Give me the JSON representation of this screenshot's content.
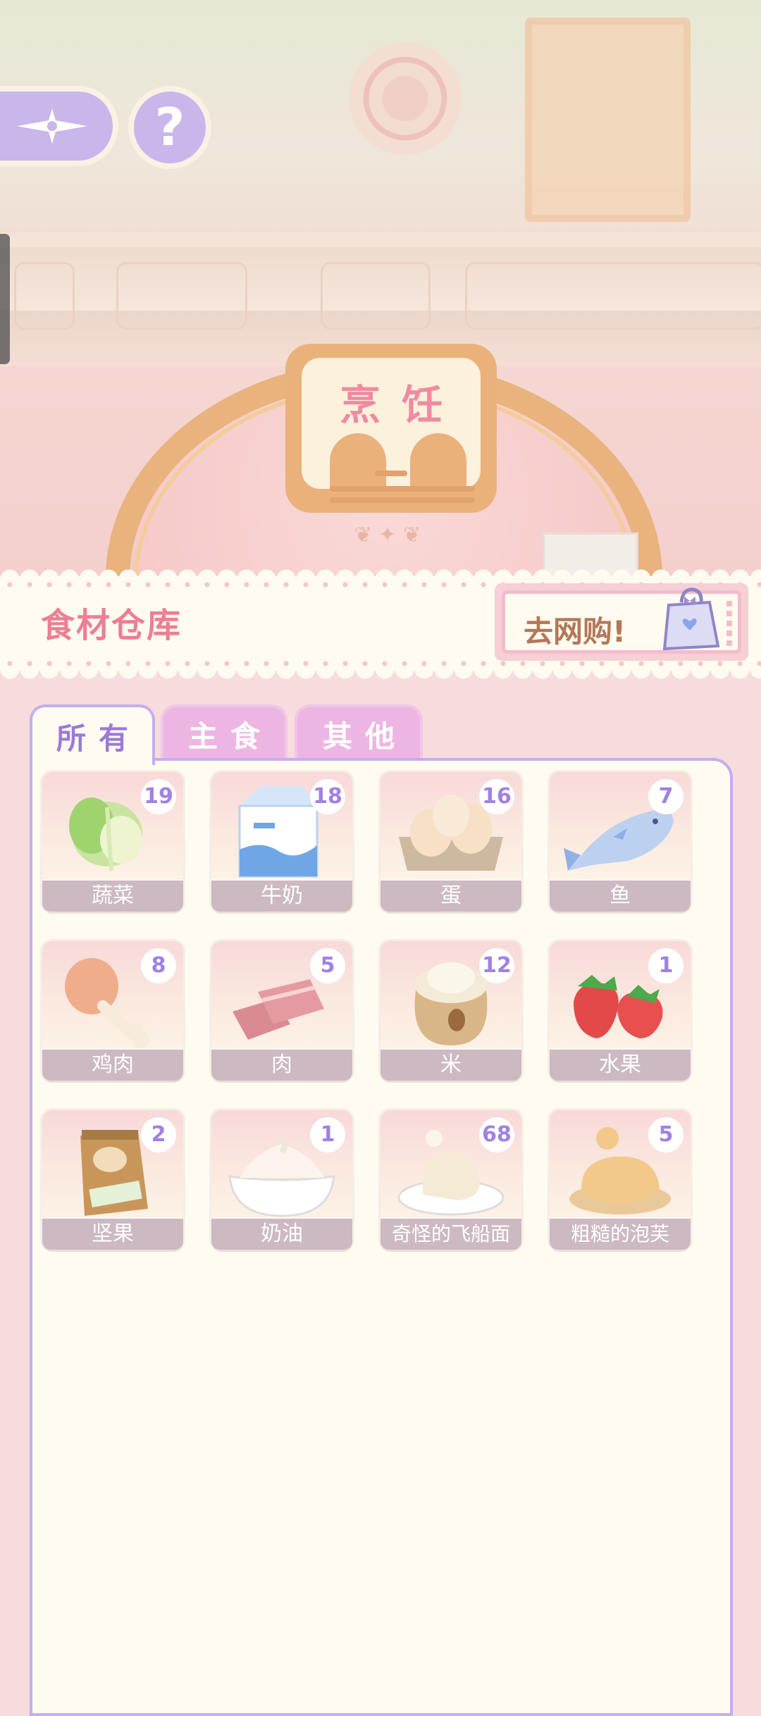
{
  "scene": {
    "sign_title": "烹饪"
  },
  "nav": {
    "back_icon": "compass-star-icon",
    "help_label": "?"
  },
  "warehouse": {
    "title": "食材仓库",
    "shop_label": "去网购!",
    "shop_icon": "shopping-bag-icon"
  },
  "tabs": [
    {
      "label": "所有",
      "active": true
    },
    {
      "label": "主食",
      "active": false
    },
    {
      "label": "其他",
      "active": false
    }
  ],
  "items": [
    {
      "name": "蔬菜",
      "count": "19",
      "icon": "cabbage-icon"
    },
    {
      "name": "牛奶",
      "count": "18",
      "icon": "milk-carton-icon"
    },
    {
      "name": "蛋",
      "count": "16",
      "icon": "eggs-icon"
    },
    {
      "name": "鱼",
      "count": "7",
      "icon": "fish-icon"
    },
    {
      "name": "鸡肉",
      "count": "8",
      "icon": "chicken-leg-icon"
    },
    {
      "name": "肉",
      "count": "5",
      "icon": "meat-icon"
    },
    {
      "name": "米",
      "count": "12",
      "icon": "rice-sack-icon"
    },
    {
      "name": "水果",
      "count": "1",
      "icon": "strawberry-icon"
    },
    {
      "name": "坚果",
      "count": "2",
      "icon": "nuts-bag-icon"
    },
    {
      "name": "奶油",
      "count": "1",
      "icon": "cream-bowl-icon"
    },
    {
      "name": "奇怪的飞船面",
      "count": "68",
      "icon": "strange-noodle-icon"
    },
    {
      "name": "粗糙的泡芙",
      "count": "5",
      "icon": "cream-puff-icon"
    }
  ],
  "colors": {
    "accent_purple": "#c3aef0",
    "count_text": "#9f82e3",
    "title_pink": "#ec7e96",
    "panel_bg": "#fffbf0"
  }
}
